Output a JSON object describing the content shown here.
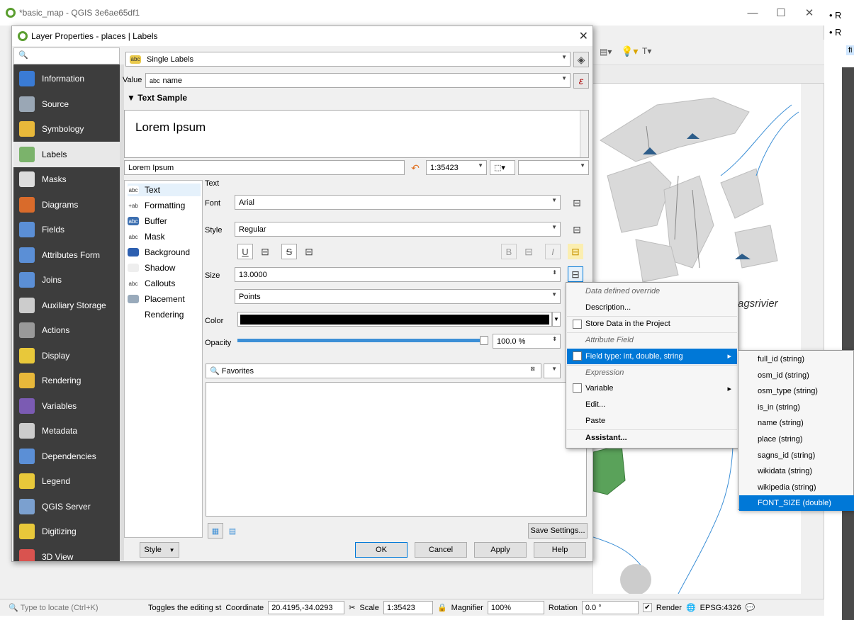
{
  "main_window": {
    "title": "*basic_map - QGIS 3e6ae65df1"
  },
  "side_note": {
    "bullets": [
      "R",
      "R"
    ],
    "highlight_text": "fi"
  },
  "map": {
    "river_label": "agsrivier"
  },
  "statusbar": {
    "locate_placeholder": "Type to locate (Ctrl+K)",
    "hint": "Toggles the editing st",
    "coordinate_label": "Coordinate",
    "coordinate_value": "20.4195,-34.0293",
    "scale_label": "Scale",
    "scale_value": "1:35423",
    "magnifier_label": "Magnifier",
    "magnifier_value": "100%",
    "rotation_label": "Rotation",
    "rotation_value": "0.0 °",
    "render_label": "Render",
    "crs": "EPSG:4326"
  },
  "dialog": {
    "title": "Layer Properties - places | Labels",
    "search_placeholder": "",
    "nav": [
      {
        "label": "Information",
        "icon": "info-icon",
        "color": "#3a7bd5"
      },
      {
        "label": "Source",
        "icon": "wrench-icon",
        "color": "#9aa7b5"
      },
      {
        "label": "Symbology",
        "icon": "paintbrush-icon",
        "color": "#e8b83a"
      },
      {
        "label": "Labels",
        "icon": "labels-abc-icon",
        "color": "#7bb36b"
      },
      {
        "label": "Masks",
        "icon": "masks-abc-icon",
        "color": "#dddddd"
      },
      {
        "label": "Diagrams",
        "icon": "diagram-icon",
        "color": "#d96b2b"
      },
      {
        "label": "Fields",
        "icon": "fields-icon",
        "color": "#5b8fd6"
      },
      {
        "label": "Attributes Form",
        "icon": "form-icon",
        "color": "#5b8fd6"
      },
      {
        "label": "Joins",
        "icon": "joins-icon",
        "color": "#5b8fd6"
      },
      {
        "label": "Auxiliary Storage",
        "icon": "storage-icon",
        "color": "#cccccc"
      },
      {
        "label": "Actions",
        "icon": "actions-icon",
        "color": "#999999"
      },
      {
        "label": "Display",
        "icon": "display-icon",
        "color": "#e8c83a"
      },
      {
        "label": "Rendering",
        "icon": "rendering-icon",
        "color": "#e8b83a"
      },
      {
        "label": "Variables",
        "icon": "variables-icon",
        "color": "#7b5bb3"
      },
      {
        "label": "Metadata",
        "icon": "metadata-icon",
        "color": "#cccccc"
      },
      {
        "label": "Dependencies",
        "icon": "dependencies-icon",
        "color": "#5b8fd6"
      },
      {
        "label": "Legend",
        "icon": "legend-icon",
        "color": "#e8c83a"
      },
      {
        "label": "QGIS Server",
        "icon": "server-icon",
        "color": "#7ba0cf"
      },
      {
        "label": "Digitizing",
        "icon": "digitizing-icon",
        "color": "#e8c83a"
      },
      {
        "label": "3D View",
        "icon": "3d-icon",
        "color": "#d9534f"
      }
    ],
    "mode": "Single Labels",
    "value_label": "Value",
    "value_field": "name",
    "value_type_tag": "abc",
    "text_sample_header": "Text Sample",
    "sample_text": "Lorem Ipsum",
    "sample_input": "Lorem Ipsum",
    "sample_scale": "1:35423",
    "subnav": [
      {
        "label": "Text",
        "tag": "abc"
      },
      {
        "label": "Formatting",
        "tag": "+ab"
      },
      {
        "label": "Buffer",
        "tag": "abc"
      },
      {
        "label": "Mask",
        "tag": "abc"
      },
      {
        "label": "Background",
        "tag": ""
      },
      {
        "label": "Shadow",
        "tag": ""
      },
      {
        "label": "Callouts",
        "tag": "abc"
      },
      {
        "label": "Placement",
        "tag": ""
      },
      {
        "label": "Rendering",
        "tag": ""
      }
    ],
    "text_panel": {
      "header": "Text",
      "font_label": "Font",
      "font_value": "Arial",
      "style_label": "Style",
      "style_value": "Regular",
      "underline": "U",
      "strike": "S",
      "bold": "B",
      "italic": "I",
      "size_label": "Size",
      "size_value": "13.0000",
      "unit_value": "Points",
      "color_label": "Color",
      "color_value": "#000000",
      "opacity_label": "Opacity",
      "opacity_value": "100.0 %",
      "opacity_fraction": 1.0,
      "favorites_placeholder": "Favorites",
      "save_settings": "Save Settings..."
    },
    "buttons": {
      "style": "Style",
      "ok": "OK",
      "cancel": "Cancel",
      "apply": "Apply",
      "help": "Help"
    }
  },
  "context_menu": {
    "items": [
      {
        "label": "Data defined override",
        "kind": "section"
      },
      {
        "label": "Description...",
        "kind": "action"
      },
      {
        "label": "Store Data in the Project",
        "kind": "check"
      },
      {
        "label": "Attribute Field",
        "kind": "section"
      },
      {
        "label": "Field type: int, double, string",
        "kind": "submenu-highlight"
      },
      {
        "label": "Expression",
        "kind": "section"
      },
      {
        "label": "Variable",
        "kind": "submenu-check"
      },
      {
        "label": "Edit...",
        "kind": "action"
      },
      {
        "label": "Paste",
        "kind": "action"
      },
      {
        "label": "Assistant...",
        "kind": "bold"
      }
    ]
  },
  "field_submenu": {
    "items": [
      "full_id  (string)",
      "osm_id  (string)",
      "osm_type  (string)",
      "is_in  (string)",
      "name  (string)",
      "place  (string)",
      "sagns_id  (string)",
      "wikidata  (string)",
      "wikipedia  (string)",
      "FONT_SIZE  (double)"
    ],
    "highlighted_index": 9
  }
}
